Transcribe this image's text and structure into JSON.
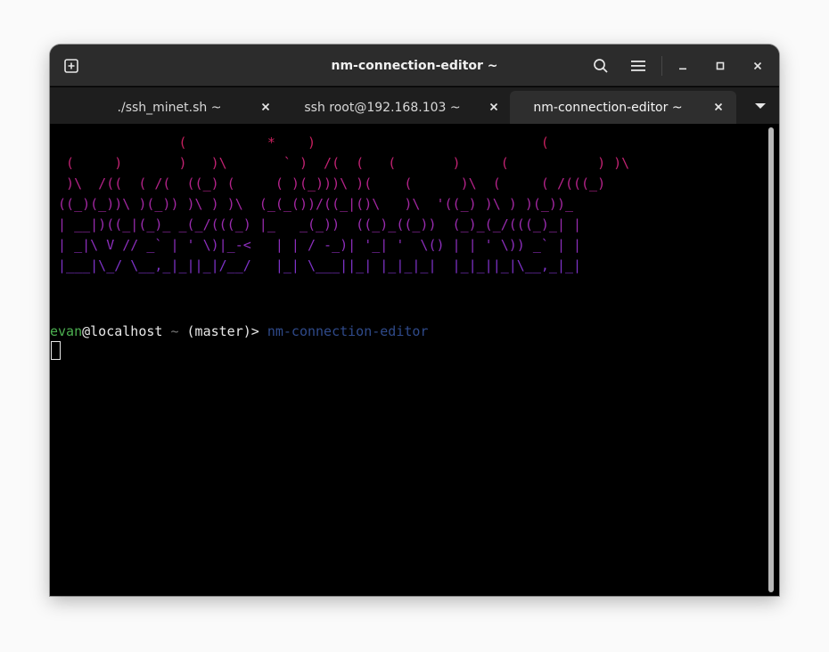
{
  "window": {
    "title": "nm-connection-editor ~"
  },
  "tabs": [
    {
      "label": "./ssh_minet.sh ~"
    },
    {
      "label": "ssh root@192.168.103 ~"
    },
    {
      "label": "nm-connection-editor ~"
    }
  ],
  "ascii_art": [
    "                (          *    )                            (",
    "  (     )       )   )\\       ` )  /(  (   (       )     (           ) )\\",
    "  )\\  /((  ( /(  ((_) (     ( )(_)))\\ )(    (      )\\  (     ( /(((_)",
    " ((_)(_))\\ )(_)) )\\ ) )\\  (_(_())/((_|()\\   )\\  '((_) )\\ ) )(_))_",
    " | __|)((_|(_)_ _(_/(((_) |_   _(_))  ((_)_((_))  (_)_(_/(((_)_| |",
    " | _|\\ V // _` | ' \\)|_-<   | | / -_)| '_| '  \\() | | ' \\)) _` | |",
    " |___|\\_/ \\__,_|_||_|/__/   |_| \\___||_| |_|_|_|  |_|_||_|\\__,_|_|"
  ],
  "ascii_colors": [
    "#c8205e",
    "#c22272",
    "#b6238a",
    "#a427a2",
    "#9a2cb0",
    "#8c2ebc",
    "#7e32c8"
  ],
  "terminal": {
    "user": "evan",
    "host": "@localhost",
    "tilde": "~",
    "branch": "(master)>",
    "command": "nm-connection-editor"
  },
  "colors": {
    "user_green": "#4caf50",
    "command_blue": "#2f4a8a"
  },
  "icons": {
    "new_tab": "plus-box-icon",
    "search": "search-icon",
    "menu": "hamburger-icon",
    "minimize": "minimize-icon",
    "maximize": "maximize-icon",
    "close": "close-icon",
    "tab_close": "close-icon",
    "tabs_dropdown": "chevron-down-icon"
  }
}
